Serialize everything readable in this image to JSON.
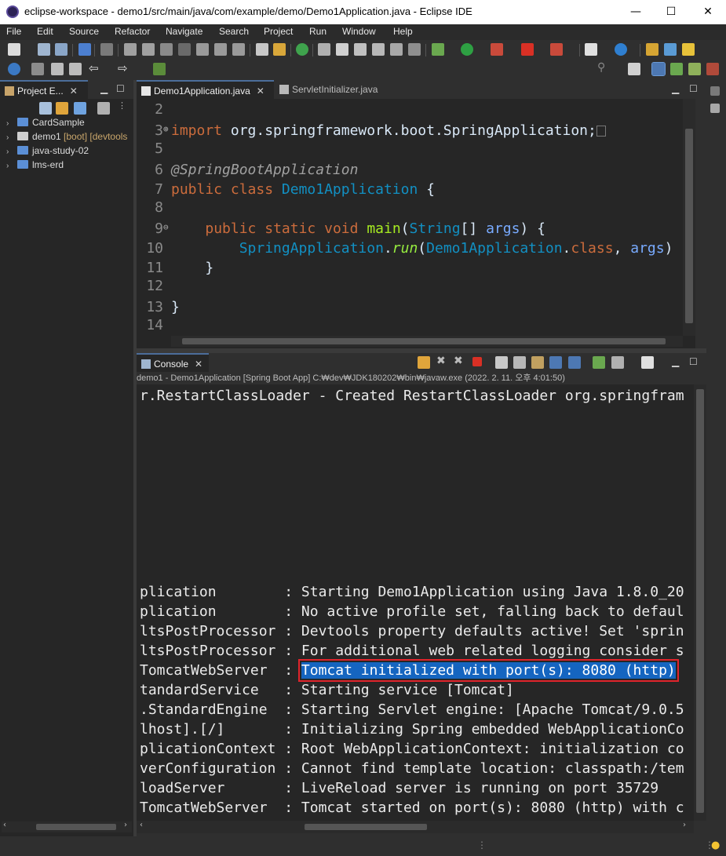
{
  "window": {
    "title": "eclipse-workspace - demo1/src/main/java/com/example/demo/Demo1Application.java - Eclipse IDE",
    "minimize": "—",
    "maximize": "☐",
    "close": "✕"
  },
  "menu": [
    "File",
    "Edit",
    "Source",
    "Refactor",
    "Navigate",
    "Search",
    "Project",
    "Run",
    "Window",
    "Help"
  ],
  "project_explorer": {
    "tab_label": "Project E...",
    "items": [
      {
        "name": "CardSample",
        "decoration": ""
      },
      {
        "name": "demo1",
        "decoration": "[boot] [devtools"
      },
      {
        "name": "java-study-02",
        "decoration": ""
      },
      {
        "name": "lms-erd",
        "decoration": ""
      }
    ]
  },
  "editor": {
    "tabs": [
      {
        "label": "Demo1Application.java",
        "active": true
      },
      {
        "label": "ServletInitializer.java",
        "active": false
      }
    ],
    "lines": [
      {
        "num": "2"
      },
      {
        "num": "3",
        "kw": "import",
        "text": " org.springframework.boot.SpringApplication;"
      },
      {
        "num": "5"
      },
      {
        "num": "6",
        "ann": "@SpringBootApplication"
      },
      {
        "num": "7",
        "kw1": "public",
        "kw2": "class",
        "cls": "Demo1Application",
        "tail": " {"
      },
      {
        "num": "8"
      },
      {
        "num": "9",
        "kw1": "public",
        "kw2": "static",
        "kw3": "void",
        "meth": "main",
        "open": "(",
        "type": "String",
        "arr": "[] ",
        "arg": "args",
        "tail": ") {"
      },
      {
        "num": "10",
        "cls": "SpringApplication",
        "dot": ".",
        "meth": "run",
        "open": "(",
        "cls2": "Demo1Application",
        "dot2": ".",
        "kw": "class",
        "comma": ", ",
        "arg": "args",
        "tail": ")"
      },
      {
        "num": "11",
        "tail": "}"
      },
      {
        "num": "12"
      },
      {
        "num": "13",
        "tail": "}"
      },
      {
        "num": "14"
      }
    ]
  },
  "console": {
    "tab_label": "Console",
    "launch_info": "demo1 - Demo1Application [Spring Boot App] C:₩dev₩JDK180202₩bin₩javaw.exe  (2022. 2. 11. 오후 4:01:50)",
    "first_line": "r.RestartClassLoader - Created RestartClassLoader org.springfram",
    "lines": [
      {
        "source": "plication        ",
        "message": "Starting Demo1Application using Java 1.8.0_20"
      },
      {
        "source": "plication        ",
        "message": "No active profile set, falling back to defaul"
      },
      {
        "source": "ltsPostProcessor ",
        "message": "Devtools property defaults active! Set 'sprin"
      },
      {
        "source": "ltsPostProcessor ",
        "message": "For additional web related logging consider s"
      },
      {
        "source": "TomcatWebServer  ",
        "message": "Tomcat initialized with port(s): 8080 (http)",
        "highlight": true
      },
      {
        "source": "tandardService   ",
        "message": "Starting service [Tomcat]"
      },
      {
        "source": ".StandardEngine  ",
        "message": "Starting Servlet engine: [Apache Tomcat/9.0.5"
      },
      {
        "source": "lhost].[/]       ",
        "message": "Initializing Spring embedded WebApplicationCo"
      },
      {
        "source": "plicationContext ",
        "message": "Root WebApplicationContext: initialization co"
      },
      {
        "source": "verConfiguration ",
        "message": "Cannot find template location: classpath:/tem"
      },
      {
        "source": "loadServer       ",
        "message": "LiveReload server is running on port 35729"
      },
      {
        "source": "TomcatWebServer  ",
        "message": "Tomcat started on port(s): 8080 (http) with c"
      }
    ],
    "separator": ": "
  }
}
